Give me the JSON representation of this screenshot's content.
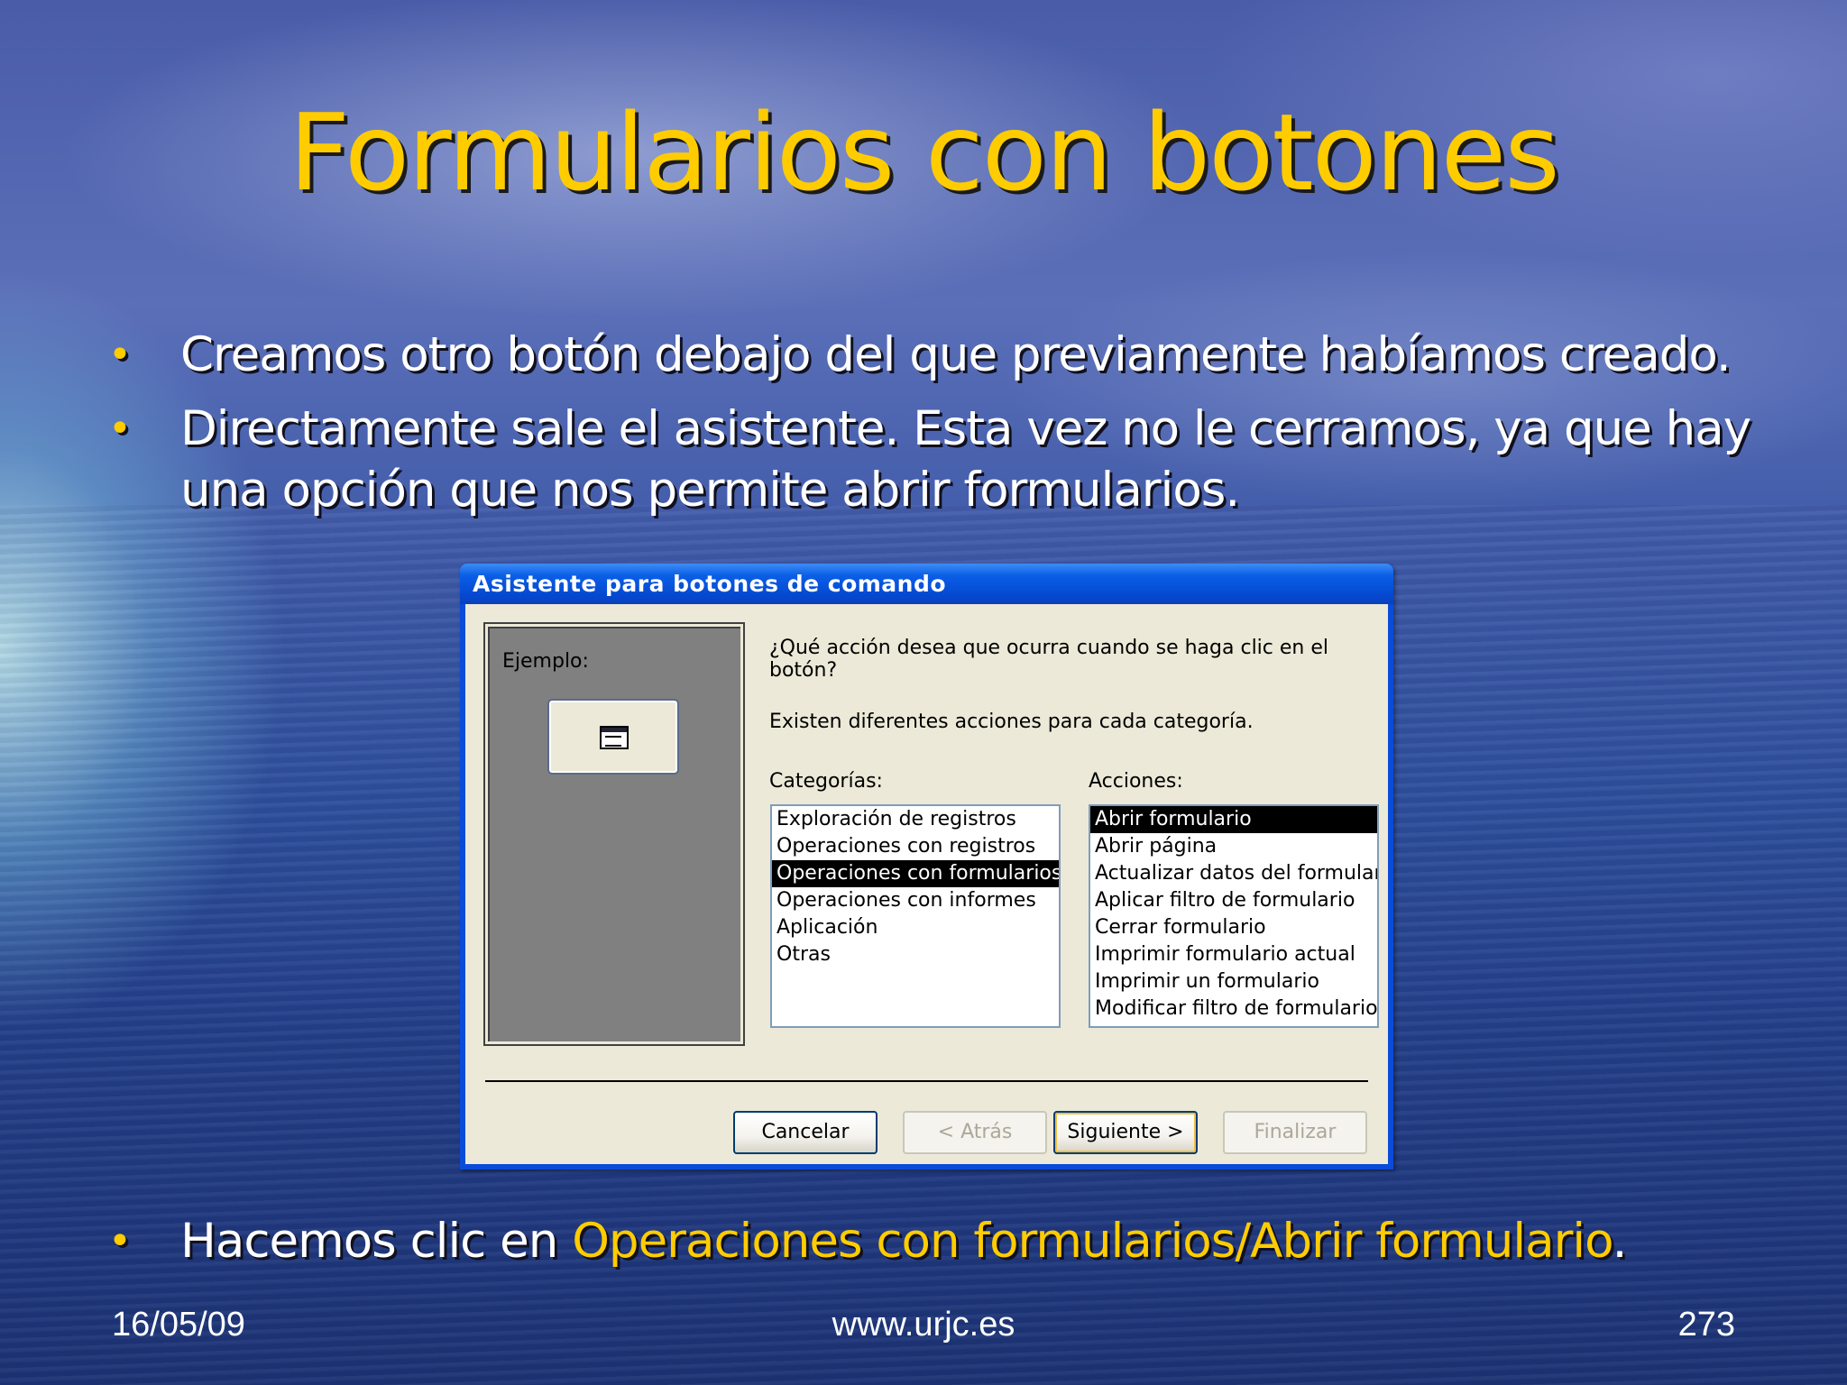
{
  "slide": {
    "title": "Formularios con botones",
    "bullets": [
      "Creamos otro botón debajo del que previamente habíamos creado.",
      "Directamente sale el asistente. Esta vez no le cerramos, ya que hay una opción que nos permite abrir formularios."
    ],
    "bullet3": {
      "prefix": "Hacemos clic en ",
      "highlight": "Operaciones con formularios/Abrir formulario",
      "suffix": "."
    },
    "bullet_glyph": "•",
    "footer": {
      "date": "16/05/09",
      "site": "www.urjc.es",
      "page": "273"
    },
    "colors": {
      "title": "#ffcc00",
      "highlight": "#ffcc00",
      "text": "#ffffff"
    }
  },
  "dialog": {
    "title": "Asistente para botones de comando",
    "example_label": "Ejemplo:",
    "example_icon": "form-icon",
    "question": "¿Qué acción desea que ocurra cuando se haga clic en el botón?",
    "info": "Existen diferentes acciones para cada categoría.",
    "categories_label": "Categorías:",
    "actions_label": "Acciones:",
    "categories": [
      "Exploración de registros",
      "Operaciones con registros",
      "Operaciones con formularios",
      "Operaciones con informes",
      "Aplicación",
      "Otras"
    ],
    "categories_selected": "Operaciones con formularios",
    "actions": [
      "Abrir formulario",
      "Abrir página",
      "Actualizar datos del formulario",
      "Aplicar filtro de formulario",
      "Cerrar formulario",
      "Imprimir formulario actual",
      "Imprimir un formulario",
      "Modificar filtro de formulario"
    ],
    "actions_selected": "Abrir formulario",
    "buttons": {
      "cancel": "Cancelar",
      "back": "< Atrás",
      "next": "Siguiente >",
      "finish": "Finalizar"
    }
  }
}
